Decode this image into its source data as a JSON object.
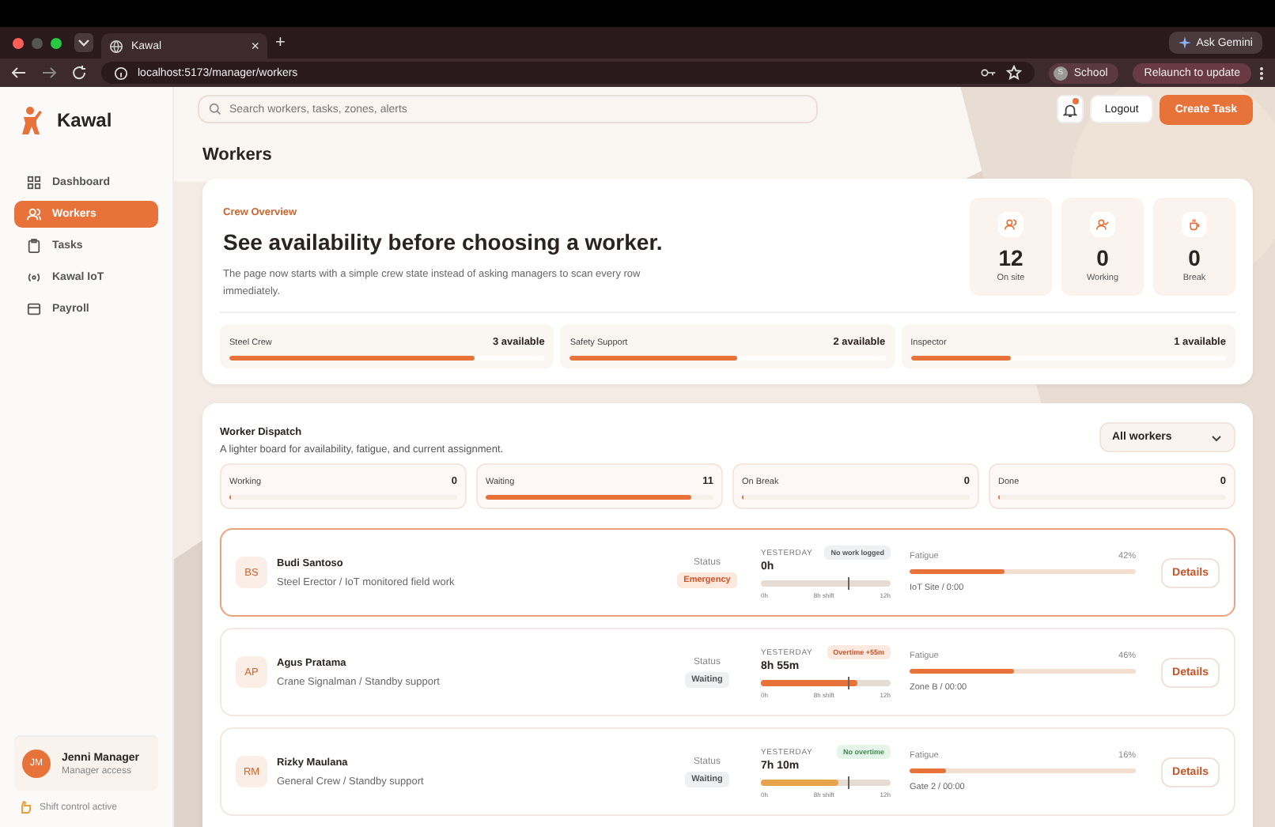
{
  "browser": {
    "tab_title": "Kawal",
    "tab_close": "×",
    "new_tab": "+",
    "ask": "Ask Gemini",
    "url": "localhost:5173/manager/workers",
    "profile": "School",
    "profile_initial": "S",
    "relaunch": "Relaunch to update"
  },
  "sidebar": {
    "brand": "Kawal",
    "items": [
      {
        "label": "Dashboard",
        "selected": false
      },
      {
        "label": "Workers",
        "selected": true
      },
      {
        "label": "Tasks",
        "selected": false
      },
      {
        "label": "Kawal IoT",
        "selected": false
      },
      {
        "label": "Payroll",
        "selected": false
      }
    ],
    "user": {
      "initials": "JM",
      "name": "Jenni Manager",
      "role": "Manager access"
    },
    "status": "Shift control active"
  },
  "topbar": {
    "search": {
      "placeholder": "Search workers, tasks, zones, alerts"
    },
    "notification": true,
    "logout": "Logout",
    "create": "Create Task"
  },
  "page_title": "Workers",
  "overview": {
    "eyebrow": "Crew Overview",
    "heading": "See availability before choosing a worker.",
    "text": "The page now starts with a simple crew state instead of asking managers to scan every row immediately.",
    "stats": [
      {
        "value": "12",
        "label": "On site"
      },
      {
        "value": "0",
        "label": "Working"
      },
      {
        "value": "0",
        "label": "Break"
      }
    ],
    "crews": [
      {
        "name": "Steel Crew",
        "available": "3 available",
        "level": 0.78
      },
      {
        "name": "Safety Support",
        "available": "2 available",
        "level": 0.53
      },
      {
        "name": "Inspector",
        "available": "1 available",
        "level": 0.32
      }
    ]
  },
  "dispatch": {
    "title": "Worker Dispatch",
    "subtitle": "A lighter board for availability, fatigue, and current assignment.",
    "filter": "All workers",
    "states": [
      {
        "label": "Working",
        "count": "0",
        "level": 0
      },
      {
        "label": "Waiting",
        "count": "11",
        "level": 0.9
      },
      {
        "label": "On Break",
        "count": "0",
        "level": 0
      },
      {
        "label": "Done",
        "count": "0",
        "level": 0
      }
    ],
    "workers": [
      {
        "initials": "BS",
        "name": "Budi Santoso",
        "role": "Steel Erector / IoT monitored field work",
        "selected": true,
        "status_label": "Status",
        "status": {
          "text": "Emergency",
          "kind": "alert"
        },
        "day": "YESTERDAY",
        "hours": "0h",
        "hours_tag": {
          "text": "No work logged",
          "kind": "none"
        },
        "shift": {
          "level": 0
        },
        "ticks": [
          "0h",
          "8h shift",
          "12h"
        ],
        "fatigue": {
          "label": "Fatigue",
          "value": "42%",
          "level": 0.42
        },
        "location": "IoT Site / 0:00",
        "action": "Details"
      },
      {
        "initials": "AP",
        "name": "Agus Pratama",
        "role": "Crane Signalman / Standby support",
        "selected": false,
        "status_label": "Status",
        "status": {
          "text": "Waiting",
          "kind": "idle"
        },
        "day": "YESTERDAY",
        "hours": "8h 55m",
        "hours_tag": {
          "text": "Overtime +55m",
          "kind": "overtime"
        },
        "shift": {
          "level": 0.74
        },
        "ticks": [
          "0h",
          "8h shift",
          "12h"
        ],
        "fatigue": {
          "label": "Fatigue",
          "value": "46%",
          "level": 0.46
        },
        "location": "Zone B / 00:00",
        "action": "Details"
      },
      {
        "initials": "RM",
        "name": "Rizky Maulana",
        "role": "General Crew / Standby support",
        "selected": false,
        "status_label": "Status",
        "status": {
          "text": "Waiting",
          "kind": "idle"
        },
        "day": "YESTERDAY",
        "hours": "7h 10m",
        "hours_tag": {
          "text": "No overtime",
          "kind": "ok"
        },
        "shift": {
          "level": 0.6
        },
        "ticks": [
          "0h",
          "8h shift",
          "12h"
        ],
        "fatigue": {
          "label": "Fatigue",
          "value": "16%",
          "level": 0.16
        },
        "location": "Gate 2 / 00:00",
        "action": "Details"
      }
    ]
  }
}
